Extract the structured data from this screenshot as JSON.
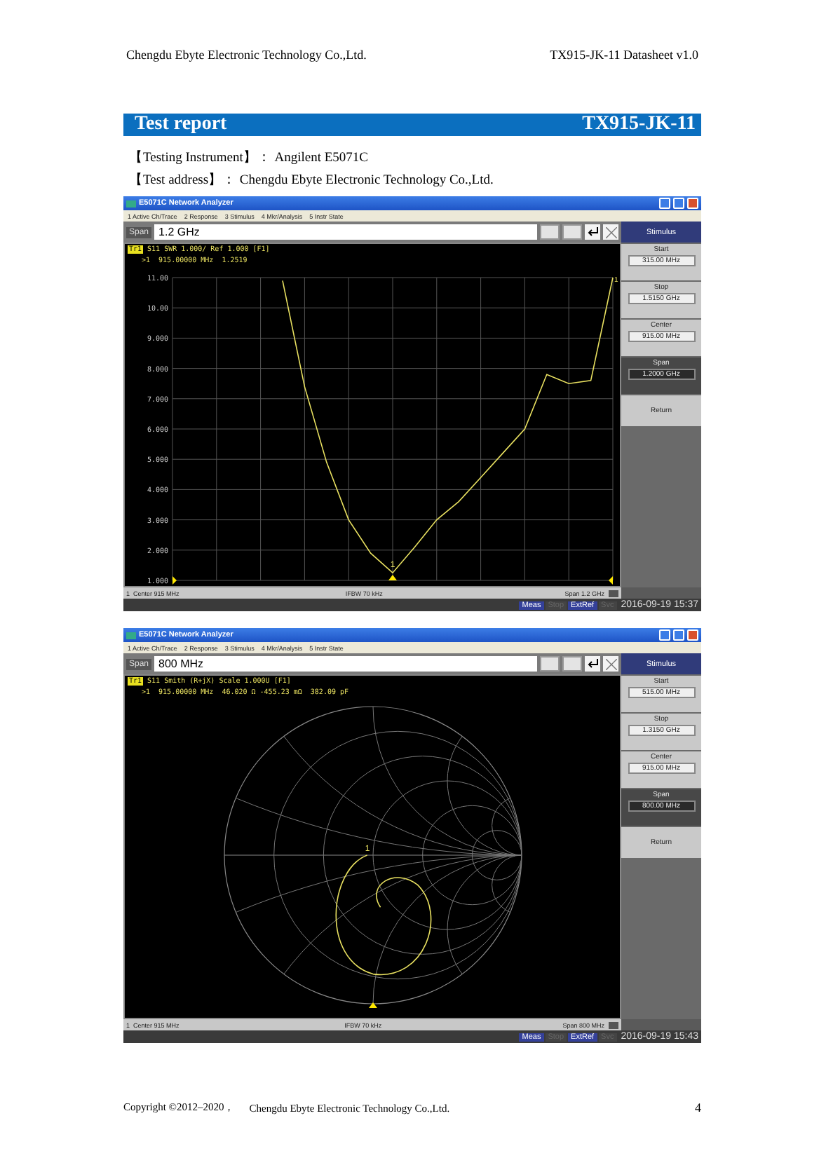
{
  "header": {
    "company": "Chengdu Ebyte Electronic Technology Co.,Ltd.",
    "document": "TX915-JK-11 Datasheet v1.0"
  },
  "section": {
    "title": "Test report",
    "model": "TX915-JK-11"
  },
  "info_lines": [
    "【Testing Instrument】： Angilent E5071C",
    "【Test address】： Chengdu Ebyte Electronic Technology Co.,Ltd."
  ],
  "analyzers": [
    {
      "kind": "swr",
      "title": "E5071C Network Analyzer",
      "menu": [
        "1 Active Ch/Trace",
        "2 Response",
        "3 Stimulus",
        "4 Mkr/Analysis",
        "5 Instr State"
      ],
      "entry": {
        "label": "Span",
        "value": "1.2 GHz"
      },
      "stimulus_button": "Stimulus",
      "softkeys": [
        {
          "label": "Start",
          "value": "315.00 MHz",
          "selected": false
        },
        {
          "label": "Stop",
          "value": "1.5150 GHz",
          "selected": false
        },
        {
          "label": "Center",
          "value": "915.00 MHz",
          "selected": false
        },
        {
          "label": "Span",
          "value": "1.2000 GHz",
          "selected": true
        }
      ],
      "return_button": "Return",
      "trace": {
        "tag": "Tr1",
        "header": "SWR 1.000/ Ref 1.000 [F1]",
        "readout": ">1  915.00000 MHz  1.2519",
        "marker_label": "1",
        "ref_label": "1"
      },
      "chart_data": {
        "type": "line",
        "categories": [
          null,
          null,
          null,
          null,
          null,
          null,
          null,
          null,
          null,
          null,
          null,
          null,
          null,
          null,
          null,
          null,
          null,
          null,
          null,
          null,
          null
        ],
        "series": [
          {
            "name": "S11",
            "color": "#e8e060",
            "values": [
              null,
              null,
              null,
              null,
              null,
              10.9,
              7.4,
              4.9,
              3.0,
              1.9,
              1.25,
              2.1,
              3.0,
              3.6,
              4.4,
              5.2,
              6.0,
              7.8,
              7.5,
              7.6,
              11
            ]
          }
        ],
        "ylim": [
          1,
          11
        ],
        "grid": true,
        "yticks": [
          {
            "value": 1,
            "label": "1.000"
          },
          {
            "value": 2,
            "label": "2.000"
          },
          {
            "value": 3,
            "label": "3.000"
          },
          {
            "value": 4,
            "label": "4.000"
          },
          {
            "value": 5,
            "label": "5.000"
          },
          {
            "value": 6,
            "label": "6.000"
          },
          {
            "value": 7,
            "label": "7.000"
          },
          {
            "value": 8,
            "label": "8.000"
          },
          {
            "value": 9,
            "label": "9.000"
          },
          {
            "value": 10,
            "label": "10.00"
          },
          {
            "value": 11,
            "label": "11.00"
          }
        ]
      },
      "status": {
        "center": "1  Center 915 MHz",
        "ifbw": "IFBW 70 kHz",
        "span": "Span 1.2 GHz"
      },
      "indicators": [
        {
          "label": "Meas",
          "on": true
        },
        {
          "label": "Stop",
          "on": false
        },
        {
          "label": "ExtRef",
          "on": true
        },
        {
          "label": "Svc",
          "on": false
        }
      ],
      "datetime": "2016-09-19 15:37"
    },
    {
      "kind": "smith",
      "title": "E5071C Network Analyzer",
      "menu": [
        "1 Active Ch/Trace",
        "2 Response",
        "3 Stimulus",
        "4 Mkr/Analysis",
        "5 Instr State"
      ],
      "entry": {
        "label": "Span",
        "value": "800 MHz"
      },
      "stimulus_button": "Stimulus",
      "softkeys": [
        {
          "label": "Start",
          "value": "515.00 MHz",
          "selected": false
        },
        {
          "label": "Stop",
          "value": "1.3150 GHz",
          "selected": false
        },
        {
          "label": "Center",
          "value": "915.00 MHz",
          "selected": false
        },
        {
          "label": "Span",
          "value": "800.00 MHz",
          "selected": true
        }
      ],
      "return_button": "Return",
      "trace": {
        "tag": "Tr1",
        "param": "S11",
        "header": "Smith (R+jX) Scale 1.000U [F1]",
        "readout": ">1  915.00000 MHz  46.020 Ω -455.23 mΩ  382.09 pF",
        "marker_label": "1"
      },
      "status": {
        "center": "1  Center 915 MHz",
        "ifbw": "IFBW 70 kHz",
        "span": "Span 800 MHz"
      },
      "indicators": [
        {
          "label": "Meas",
          "on": true
        },
        {
          "label": "Stop",
          "on": false
        },
        {
          "label": "ExtRef",
          "on": true
        },
        {
          "label": "Svc",
          "on": false
        }
      ],
      "datetime": "2016-09-19 15:43"
    }
  ],
  "footer": {
    "copyright": "Copyright ©2012–2020，",
    "company": "Chengdu Ebyte Electronic Technology Co.,Ltd.",
    "page": "4"
  }
}
